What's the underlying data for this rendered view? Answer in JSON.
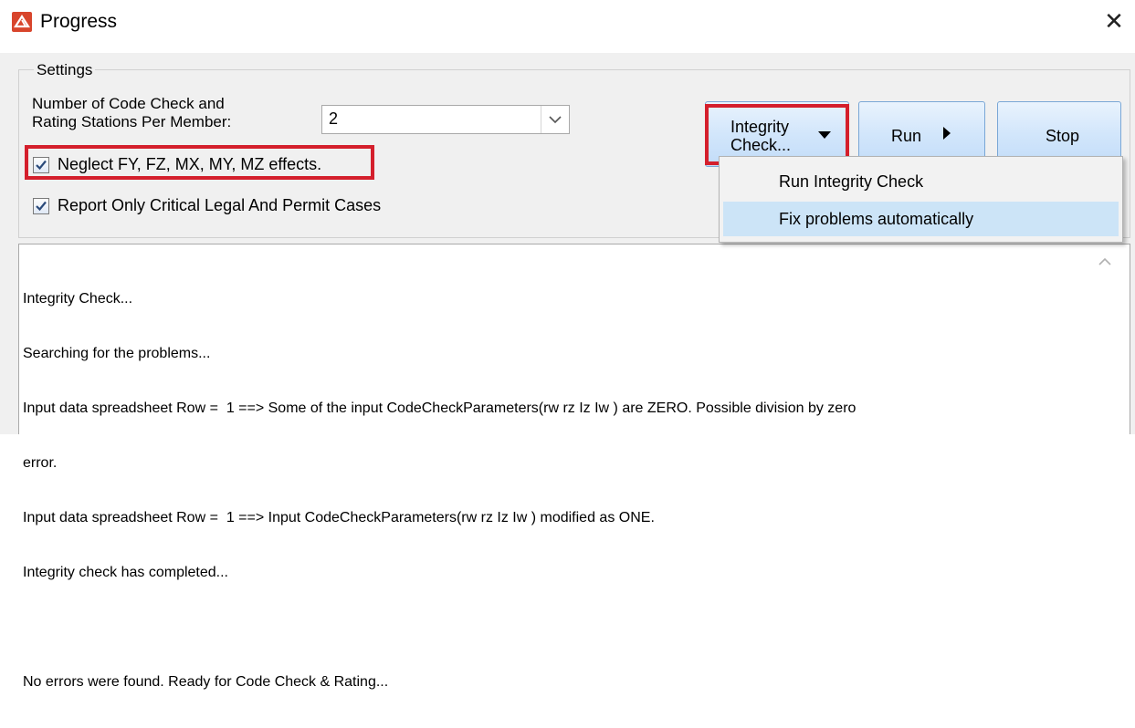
{
  "window": {
    "title": "Progress",
    "close_glyph": "✕"
  },
  "settings": {
    "legend": "Settings",
    "stations_label_line1": "Number of Code Check and",
    "stations_label_line2": "Rating Stations Per Member:",
    "stations_value": "2",
    "neglect_label": "Neglect FY, FZ, MX, MY, MZ effects.",
    "neglect_checked": true,
    "report_label": "Report Only Critical Legal And Permit Cases",
    "report_checked": true
  },
  "buttons": {
    "integrity_line1": "Integrity",
    "integrity_line2": "Check...",
    "run": "Run",
    "stop": "Stop"
  },
  "menu": {
    "items": [
      {
        "label": "Run Integrity Check",
        "selected": false
      },
      {
        "label": "Fix problems automatically",
        "selected": true
      }
    ]
  },
  "log": {
    "lines": [
      "Integrity Check...",
      "Searching for the problems...",
      "Input data spreadsheet Row =  1 ==> Some of the input CodeCheckParameters(rw rz Iz Iw ) are ZERO. Possible division by zero",
      "error.",
      "Input data spreadsheet Row =  1 ==> Input CodeCheckParameters(rw rz Iz Iw ) modified as ONE.",
      "Integrity check has completed...",
      "",
      "No errors were found. Ready for Code Check & Rating..."
    ]
  },
  "colors": {
    "highlight_red": "#d41f2c",
    "menu_selected": "#cce4f7",
    "button_border": "#7aa7d6"
  },
  "icons": {
    "app": "app-logo-icon",
    "close": "close-icon",
    "dropdown": "chevron-down-icon",
    "checkbox": "check-icon",
    "scroll_up": "scroll-up-icon"
  }
}
